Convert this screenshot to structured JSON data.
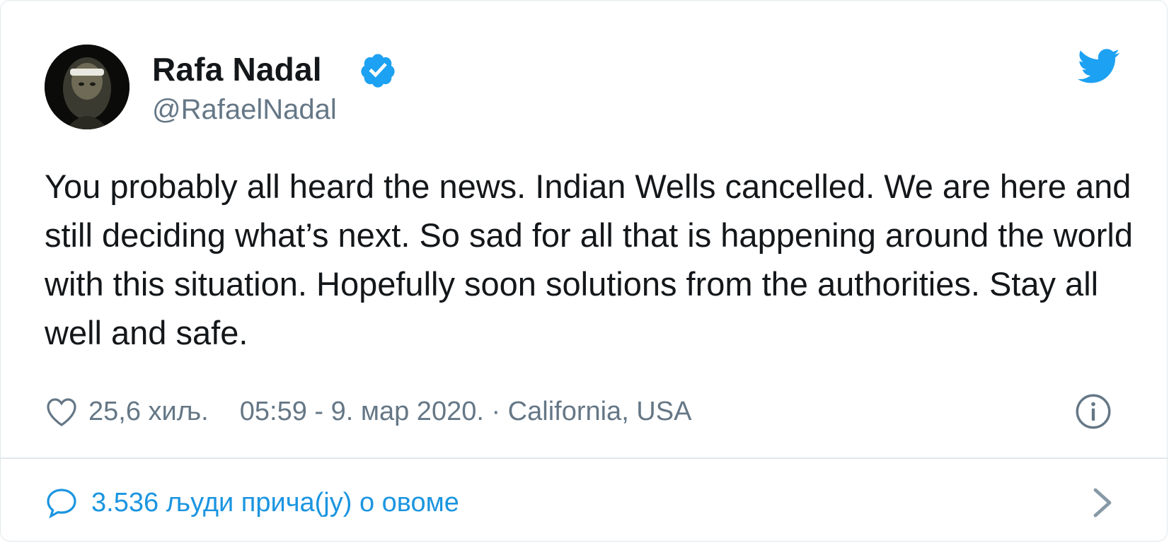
{
  "author": {
    "name": "Rafa Nadal",
    "handle": "@RafaelNadal",
    "verified": true,
    "avatar": "avatar-photo"
  },
  "tweet": {
    "text": "You probably all heard the news. Indian Wells cancelled. We are here and still deciding what’s next. So sad for all that is happening around the world with this situation. Hopefully soon solutions from the authorities. Stay all well and safe."
  },
  "meta": {
    "likes": "25,6 хиљ.",
    "timestamp": "05:59 - 9. мар 2020. · California, USA"
  },
  "footer": {
    "conversation": "3.536 људи прича(ју) о овоме"
  },
  "icons": {
    "brand": "twitter-bird-icon",
    "verified": "verified-badge-icon",
    "like": "heart-icon",
    "info": "info-icon",
    "reply": "speech-bubble-icon",
    "more": "chevron-right-icon"
  },
  "colors": {
    "brand_blue": "#1da1f2",
    "link_blue": "#1b95e0",
    "text": "#14171a",
    "secondary_text": "#657786",
    "border": "#e1e8ed"
  }
}
